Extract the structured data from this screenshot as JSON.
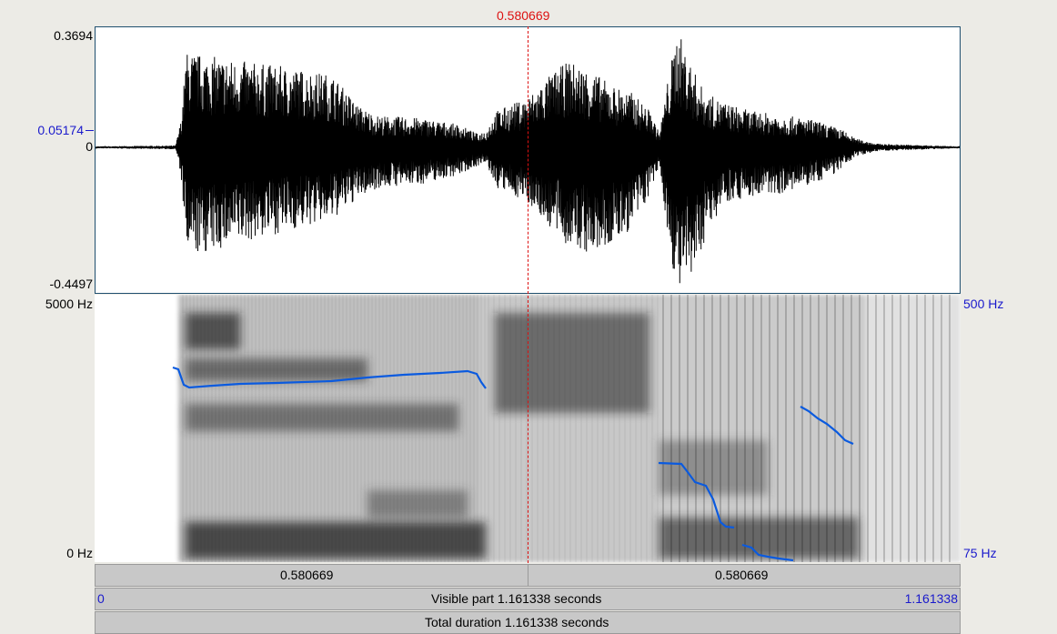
{
  "cursor": {
    "time_label": "0.580669",
    "color": "#dd1111"
  },
  "waveform": {
    "y_max": "0.3694",
    "y_mark": "0.05174",
    "y_zero": "0",
    "y_min": "-0.4497",
    "y_mark_color": "#1a1acc"
  },
  "spectrogram": {
    "freq_max": "5000 Hz",
    "freq_min": "0 Hz",
    "pitch_max": "500 Hz",
    "pitch_min": "75 Hz",
    "pitch_color": "#0a5adf"
  },
  "time_bars": {
    "left_segment": "0.580669",
    "right_segment": "0.580669",
    "visible_start": "0",
    "visible_label": "Visible part 1.161338 seconds",
    "visible_end": "1.161338",
    "total_label": "Total duration 1.161338 seconds"
  }
}
